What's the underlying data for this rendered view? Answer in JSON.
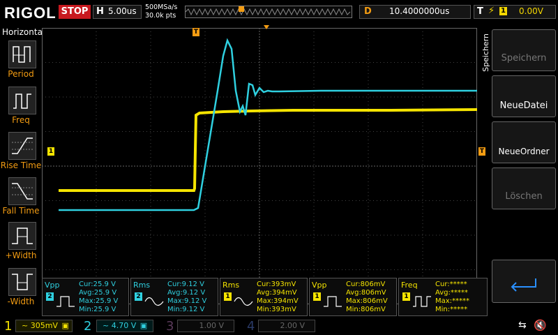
{
  "topbar": {
    "logo": "RIGOL",
    "run_state": "STOP",
    "horizontal_letter": "H",
    "timebase": "5.00us",
    "sample_rate": "500MSa/s",
    "points": "30.0k pts",
    "delay_letter": "D",
    "delay_value": "10.4000000us",
    "trigger_letter": "T",
    "trigger_channel": "1",
    "trigger_level": "0.00V"
  },
  "left_menu": {
    "title": "Horizontal",
    "items": [
      {
        "label": "Period"
      },
      {
        "label": "Freq"
      },
      {
        "label": "Rise Time"
      },
      {
        "label": "Fall Time"
      },
      {
        "label": "+Width"
      },
      {
        "label": "-Width"
      }
    ]
  },
  "right_menu": {
    "title": "Speichern",
    "buttons": [
      {
        "label": "Speichern",
        "enabled": false
      },
      {
        "label": "NeueDatei",
        "enabled": true
      },
      {
        "label": "NeueOrdner",
        "enabled": true
      },
      {
        "label": "Löschen",
        "enabled": false
      }
    ],
    "enter_icon": "return-arrow-icon"
  },
  "markers": {
    "ch1_level": "1",
    "trigger_pos": "T",
    "trigger_level": "T"
  },
  "measurements": [
    {
      "name": "Vpp",
      "ch": "2",
      "cur": "Cur:25.9 V",
      "avg": "Avg:25.9 V",
      "max": "Max:25.9 V",
      "min": "Min:25.9 V"
    },
    {
      "name": "Rms",
      "ch": "2",
      "cur": "Cur:9.12 V",
      "avg": "Avg:9.12 V",
      "max": "Max:9.12 V",
      "min": "Min:9.12 V"
    },
    {
      "name": "Rms",
      "ch": "1",
      "cur": "Cur:393mV",
      "avg": "Avg:394mV",
      "max": "Max:394mV",
      "min": "Min:393mV"
    },
    {
      "name": "Vpp",
      "ch": "1",
      "cur": "Cur:806mV",
      "avg": "Avg:806mV",
      "max": "Max:806mV",
      "min": "Min:806mV"
    },
    {
      "name": "Freq",
      "ch": "1",
      "cur": "Cur:*****",
      "avg": "Avg:*****",
      "max": "Max:*****",
      "min": "Min:*****"
    }
  ],
  "channels": [
    {
      "num": "1",
      "scale": "305mV",
      "coupling": "~"
    },
    {
      "num": "2",
      "scale": "4.70 V",
      "coupling": "~"
    },
    {
      "num": "3",
      "scale": "1.00 V",
      "coupling": ""
    },
    {
      "num": "4",
      "scale": "2.00 V",
      "coupling": ""
    }
  ],
  "colors": {
    "ch1": "#f5e400",
    "ch2": "#2fd0e0",
    "ch3": "#d040d0",
    "ch4": "#2a70ff",
    "accent": "#f39c12",
    "stop": "#c8191f"
  }
}
